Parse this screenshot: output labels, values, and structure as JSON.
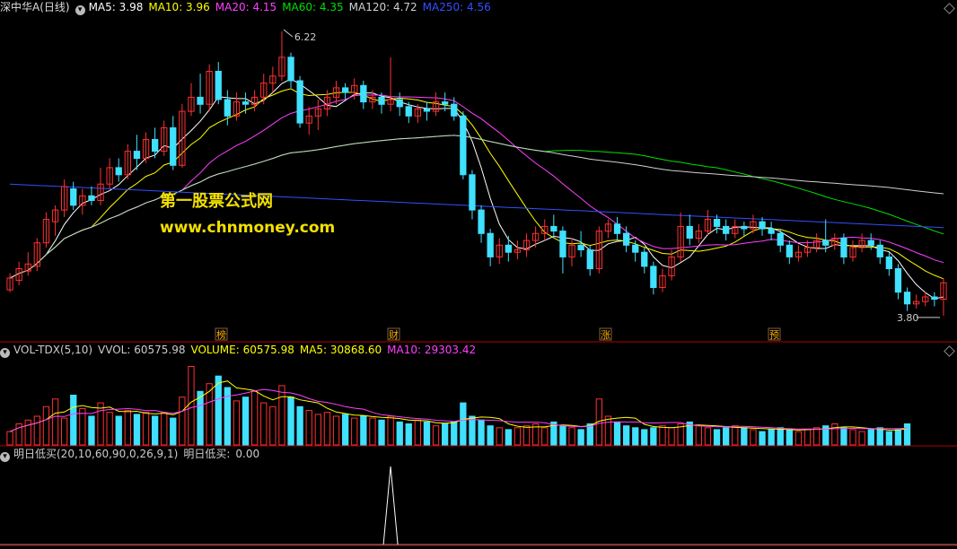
{
  "panel_main": {
    "title": "深中华A(日线)",
    "ma_values": [
      {
        "label": "MA5:",
        "value": "3.98",
        "color": "#ffffff"
      },
      {
        "label": "MA10:",
        "value": "3.96",
        "color": "#ffff00"
      },
      {
        "label": "MA20:",
        "value": "4.15",
        "color": "#ff40ff"
      },
      {
        "label": "MA60:",
        "value": "4.35",
        "color": "#00e000"
      },
      {
        "label": "MA120:",
        "value": "4.72",
        "color": "#d0d0d0"
      },
      {
        "label": "MA250:",
        "value": "4.56",
        "color": "#3050ff"
      }
    ],
    "high_label": "6.22",
    "low_label": "3.80",
    "markers": [
      "榜",
      "财",
      "涨",
      "预"
    ],
    "watermark_1": "第一股票公式网",
    "watermark_2": "www.chnmoney.com"
  },
  "panel_volume": {
    "title": "VOL-TDX(5,10)",
    "items": [
      {
        "label": "VVOL:",
        "value": "60575.98",
        "color": "#cccccc"
      },
      {
        "label": "VOLUME:",
        "value": "60575.98",
        "color": "#ffff00"
      },
      {
        "label": "MA5:",
        "value": "30868.60",
        "color": "#ffff00"
      },
      {
        "label": "MA10:",
        "value": "29303.42",
        "color": "#ff40ff"
      }
    ]
  },
  "panel_indicator": {
    "title": "明日低买(20,10,60,90,0,26,9,1)",
    "value_label": "明日低买:",
    "value": "0.00"
  },
  "colors": {
    "up": "#ff3030",
    "down": "#40e0ff",
    "border": "#b00000"
  },
  "chart_data": {
    "type": "candlestick",
    "ylim": [
      3.7,
      6.35
    ],
    "candles": [
      [
        4.02,
        4.12,
        4.0,
        4.16
      ],
      [
        4.1,
        4.2,
        4.06,
        4.26
      ],
      [
        4.18,
        4.24,
        4.14,
        4.34
      ],
      [
        4.22,
        4.42,
        4.18,
        4.46
      ],
      [
        4.42,
        4.62,
        4.38,
        4.68
      ],
      [
        4.6,
        4.7,
        4.48,
        4.74
      ],
      [
        4.7,
        4.9,
        4.64,
        4.96
      ],
      [
        4.88,
        4.74,
        4.7,
        4.94
      ],
      [
        4.74,
        4.82,
        4.66,
        4.88
      ],
      [
        4.82,
        4.78,
        4.74,
        4.9
      ],
      [
        4.78,
        4.92,
        4.74,
        5.06
      ],
      [
        4.92,
        5.06,
        4.88,
        5.14
      ],
      [
        5.06,
        5.0,
        4.94,
        5.14
      ],
      [
        5.0,
        5.2,
        4.96,
        5.26
      ],
      [
        5.2,
        5.14,
        5.04,
        5.34
      ],
      [
        5.14,
        5.3,
        5.1,
        5.36
      ],
      [
        5.3,
        5.2,
        5.14,
        5.4
      ],
      [
        5.2,
        5.4,
        5.16,
        5.46
      ],
      [
        5.4,
        5.08,
        5.04,
        5.5
      ],
      [
        5.08,
        5.54,
        5.06,
        5.6
      ],
      [
        5.54,
        5.66,
        5.5,
        5.78
      ],
      [
        5.66,
        5.6,
        5.52,
        5.86
      ],
      [
        5.6,
        5.88,
        5.54,
        5.94
      ],
      [
        5.88,
        5.64,
        5.6,
        5.96
      ],
      [
        5.64,
        5.5,
        5.42,
        5.72
      ],
      [
        5.5,
        5.62,
        5.46,
        5.7
      ],
      [
        5.62,
        5.6,
        5.52,
        5.7
      ],
      [
        5.6,
        5.66,
        5.54,
        5.72
      ],
      [
        5.66,
        5.78,
        5.6,
        5.86
      ],
      [
        5.78,
        5.84,
        5.7,
        5.92
      ],
      [
        5.84,
        6.0,
        5.8,
        6.22
      ],
      [
        6.0,
        5.8,
        5.74,
        6.04
      ],
      [
        5.8,
        5.44,
        5.4,
        5.84
      ],
      [
        5.44,
        5.5,
        5.34,
        5.58
      ],
      [
        5.5,
        5.56,
        5.38,
        5.64
      ],
      [
        5.56,
        5.66,
        5.5,
        5.72
      ],
      [
        5.66,
        5.74,
        5.6,
        5.8
      ],
      [
        5.74,
        5.7,
        5.64,
        5.78
      ],
      [
        5.7,
        5.76,
        5.64,
        5.82
      ],
      [
        5.76,
        5.62,
        5.56,
        5.8
      ],
      [
        5.62,
        5.66,
        5.56,
        5.72
      ],
      [
        5.66,
        5.6,
        5.52,
        5.7
      ],
      [
        5.6,
        5.64,
        5.54,
        6.0
      ],
      [
        5.64,
        5.58,
        5.5,
        5.7
      ],
      [
        5.58,
        5.5,
        5.44,
        5.62
      ],
      [
        5.5,
        5.56,
        5.44,
        5.6
      ],
      [
        5.56,
        5.54,
        5.46,
        5.62
      ],
      [
        5.54,
        5.62,
        5.5,
        5.7
      ],
      [
        5.62,
        5.6,
        5.54,
        5.7
      ],
      [
        5.6,
        5.5,
        5.46,
        5.66
      ],
      [
        5.5,
        5.0,
        4.96,
        5.54
      ],
      [
        5.0,
        4.7,
        4.62,
        5.04
      ],
      [
        4.7,
        4.5,
        4.42,
        4.74
      ],
      [
        4.5,
        4.3,
        4.22,
        4.54
      ],
      [
        4.3,
        4.4,
        4.24,
        4.46
      ],
      [
        4.4,
        4.34,
        4.26,
        4.48
      ],
      [
        4.34,
        4.36,
        4.28,
        4.44
      ],
      [
        4.36,
        4.44,
        4.3,
        4.5
      ],
      [
        4.44,
        4.5,
        4.38,
        4.56
      ],
      [
        4.5,
        4.56,
        4.44,
        4.62
      ],
      [
        4.56,
        4.52,
        4.46,
        4.66
      ],
      [
        4.52,
        4.3,
        4.16,
        4.56
      ],
      [
        4.3,
        4.4,
        4.22,
        4.46
      ],
      [
        4.4,
        4.36,
        4.3,
        4.52
      ],
      [
        4.36,
        4.2,
        4.14,
        4.4
      ],
      [
        4.2,
        4.52,
        4.16,
        4.56
      ],
      [
        4.52,
        4.58,
        4.46,
        4.62
      ],
      [
        4.58,
        4.5,
        4.44,
        4.64
      ],
      [
        4.5,
        4.4,
        4.34,
        4.56
      ],
      [
        4.4,
        4.34,
        4.26,
        4.44
      ],
      [
        4.34,
        4.22,
        4.16,
        4.38
      ],
      [
        4.22,
        4.04,
        3.98,
        4.26
      ],
      [
        4.04,
        4.14,
        4.0,
        4.2
      ],
      [
        4.14,
        4.3,
        4.1,
        4.36
      ],
      [
        4.3,
        4.56,
        4.26,
        4.68
      ],
      [
        4.56,
        4.46,
        4.4,
        4.66
      ],
      [
        4.46,
        4.52,
        4.42,
        4.58
      ],
      [
        4.52,
        4.62,
        4.48,
        4.7
      ],
      [
        4.62,
        4.56,
        4.5,
        4.66
      ],
      [
        4.56,
        4.5,
        4.44,
        4.62
      ],
      [
        4.5,
        4.56,
        4.46,
        4.62
      ],
      [
        4.56,
        4.54,
        4.48,
        4.6
      ],
      [
        4.54,
        4.6,
        4.5,
        4.66
      ],
      [
        4.6,
        4.54,
        4.48,
        4.64
      ],
      [
        4.54,
        4.5,
        4.44,
        4.6
      ],
      [
        4.5,
        4.4,
        4.34,
        4.54
      ],
      [
        4.4,
        4.3,
        4.24,
        4.44
      ],
      [
        4.3,
        4.34,
        4.26,
        4.4
      ],
      [
        4.34,
        4.38,
        4.3,
        4.44
      ],
      [
        4.38,
        4.44,
        4.34,
        4.5
      ],
      [
        4.44,
        4.4,
        4.34,
        4.62
      ],
      [
        4.4,
        4.46,
        4.36,
        4.5
      ],
      [
        4.46,
        4.3,
        4.24,
        4.5
      ],
      [
        4.3,
        4.38,
        4.26,
        4.44
      ],
      [
        4.38,
        4.44,
        4.34,
        4.5
      ],
      [
        4.44,
        4.4,
        4.36,
        4.5
      ],
      [
        4.4,
        4.3,
        4.24,
        4.44
      ],
      [
        4.3,
        4.2,
        4.14,
        4.34
      ],
      [
        4.2,
        4.0,
        3.94,
        4.24
      ],
      [
        4.0,
        3.9,
        3.84,
        4.04
      ],
      [
        3.9,
        3.92,
        3.86,
        3.98
      ],
      [
        3.92,
        3.96,
        3.88,
        4.0
      ],
      [
        3.96,
        3.94,
        3.88,
        4.0
      ],
      [
        3.94,
        4.08,
        3.8,
        4.12
      ]
    ],
    "volume": [
      14,
      22,
      26,
      30,
      40,
      48,
      28,
      52,
      38,
      30,
      44,
      34,
      30,
      36,
      32,
      34,
      30,
      34,
      28,
      50,
      82,
      56,
      64,
      72,
      60,
      46,
      50,
      56,
      44,
      40,
      62,
      50,
      40,
      36,
      32,
      34,
      30,
      32,
      28,
      30,
      28,
      26,
      30,
      24,
      22,
      26,
      24,
      20,
      22,
      24,
      44,
      30,
      26,
      20,
      18,
      16,
      18,
      20,
      22,
      18,
      24,
      20,
      18,
      16,
      22,
      48,
      30,
      24,
      20,
      18,
      16,
      18,
      20,
      18,
      22,
      24,
      20,
      18,
      16,
      18,
      20,
      18,
      16,
      14,
      16,
      18,
      16,
      14,
      16,
      18,
      20,
      22,
      18,
      16,
      14,
      16,
      18,
      14,
      16,
      22
    ],
    "indicator": "single spike to 1.0 at bar 42, otherwise 0"
  }
}
